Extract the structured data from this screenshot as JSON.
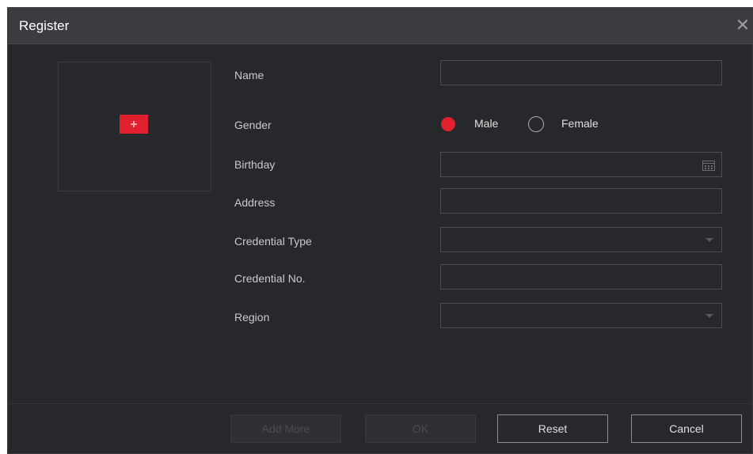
{
  "dialog": {
    "title": "Register",
    "close_icon": "close-icon"
  },
  "photo": {
    "add_icon": "add-photo-icon",
    "accent_color": "#e0202e"
  },
  "form": {
    "name": {
      "label": "Name",
      "value": ""
    },
    "gender": {
      "label": "Gender",
      "options": [
        "Male",
        "Female"
      ],
      "selected": "Male"
    },
    "birthday": {
      "label": "Birthday",
      "value": "",
      "icon": "calendar-icon"
    },
    "address": {
      "label": "Address",
      "value": ""
    },
    "credential_type": {
      "label": "Credential Type",
      "value": "",
      "icon": "chevron-down-icon"
    },
    "credential_no": {
      "label": "Credential No.",
      "value": ""
    },
    "region": {
      "label": "Region",
      "value": "",
      "icon": "chevron-down-icon"
    }
  },
  "buttons": {
    "add_more": "Add More",
    "ok": "OK",
    "reset": "Reset",
    "cancel": "Cancel"
  }
}
